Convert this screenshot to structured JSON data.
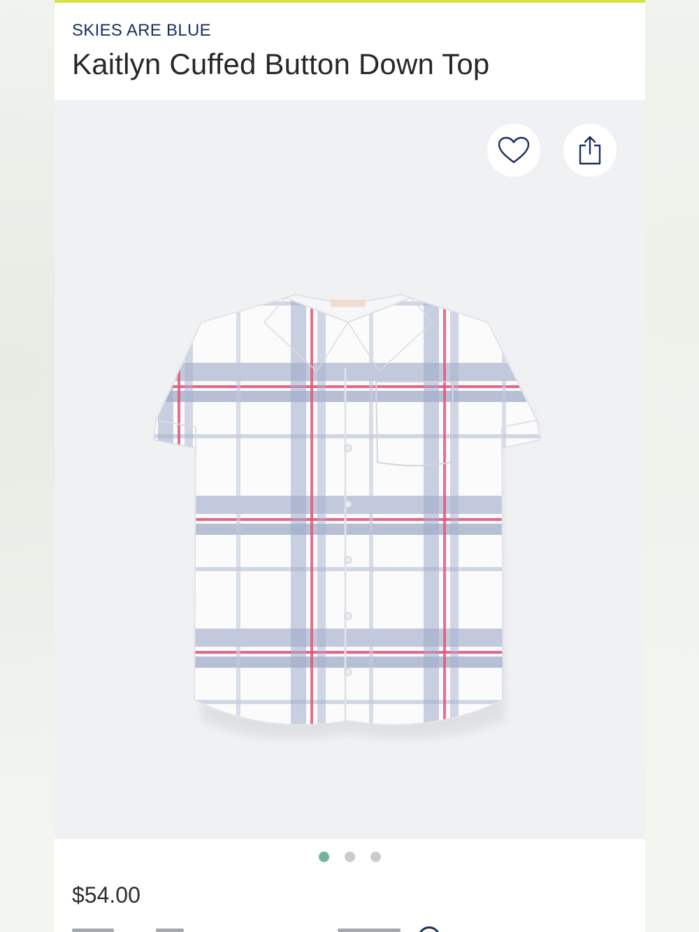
{
  "product": {
    "brand": "SKIES ARE BLUE",
    "title": "Kaitlyn Cuffed Button Down Top",
    "price": "$54.00"
  },
  "actions": {
    "favorite_icon": "heart-outline-icon",
    "share_icon": "share-upload-icon"
  },
  "carousel": {
    "total_images": 3,
    "active_index": 0
  },
  "colors": {
    "accent_bar": "#d7e344",
    "brand_text": "#1b2f5e",
    "active_dot": "#6fb59a",
    "inactive_dot": "#c9cbce",
    "image_bg": "#f0f1f3"
  }
}
